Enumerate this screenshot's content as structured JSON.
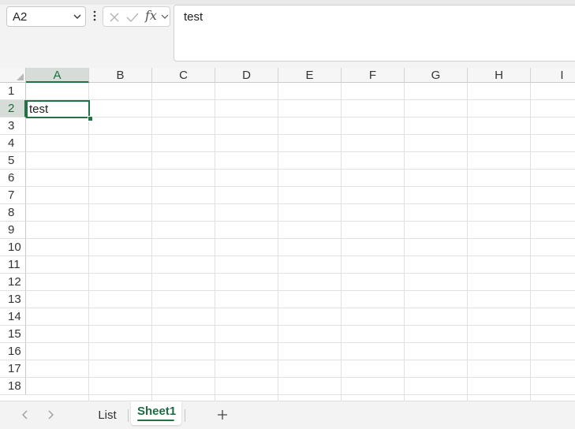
{
  "name_box": {
    "value": "A2"
  },
  "formula_bar": {
    "fx_label": "fx",
    "value": "test"
  },
  "columns": [
    "A",
    "B",
    "C",
    "D",
    "E",
    "F",
    "G",
    "H",
    "I"
  ],
  "rows": [
    "1",
    "2",
    "3",
    "4",
    "5",
    "6",
    "7",
    "8",
    "9",
    "10",
    "11",
    "12",
    "13",
    "14",
    "15",
    "16",
    "17",
    "18"
  ],
  "selection": {
    "column": "A",
    "row": "2"
  },
  "cells": {
    "A2": "test"
  },
  "sheet_tabs": [
    {
      "label": "List",
      "active": false
    },
    {
      "label": "Sheet1",
      "active": true
    }
  ],
  "icons": {
    "name_box_dropdown": "chevron-down-icon",
    "more_options": "vertical-dots-icon",
    "cancel": "close-icon",
    "enter": "check-icon",
    "formula_dropdown": "chevron-down-icon",
    "prev_sheet": "chevron-left-icon",
    "next_sheet": "chevron-right-icon",
    "add_sheet": "plus-icon"
  },
  "colors": {
    "accent": "#217346",
    "header_bg": "#f6f6f6",
    "selected_header_bg": "#d6ddd8",
    "gridline": "#e1e1e1"
  }
}
